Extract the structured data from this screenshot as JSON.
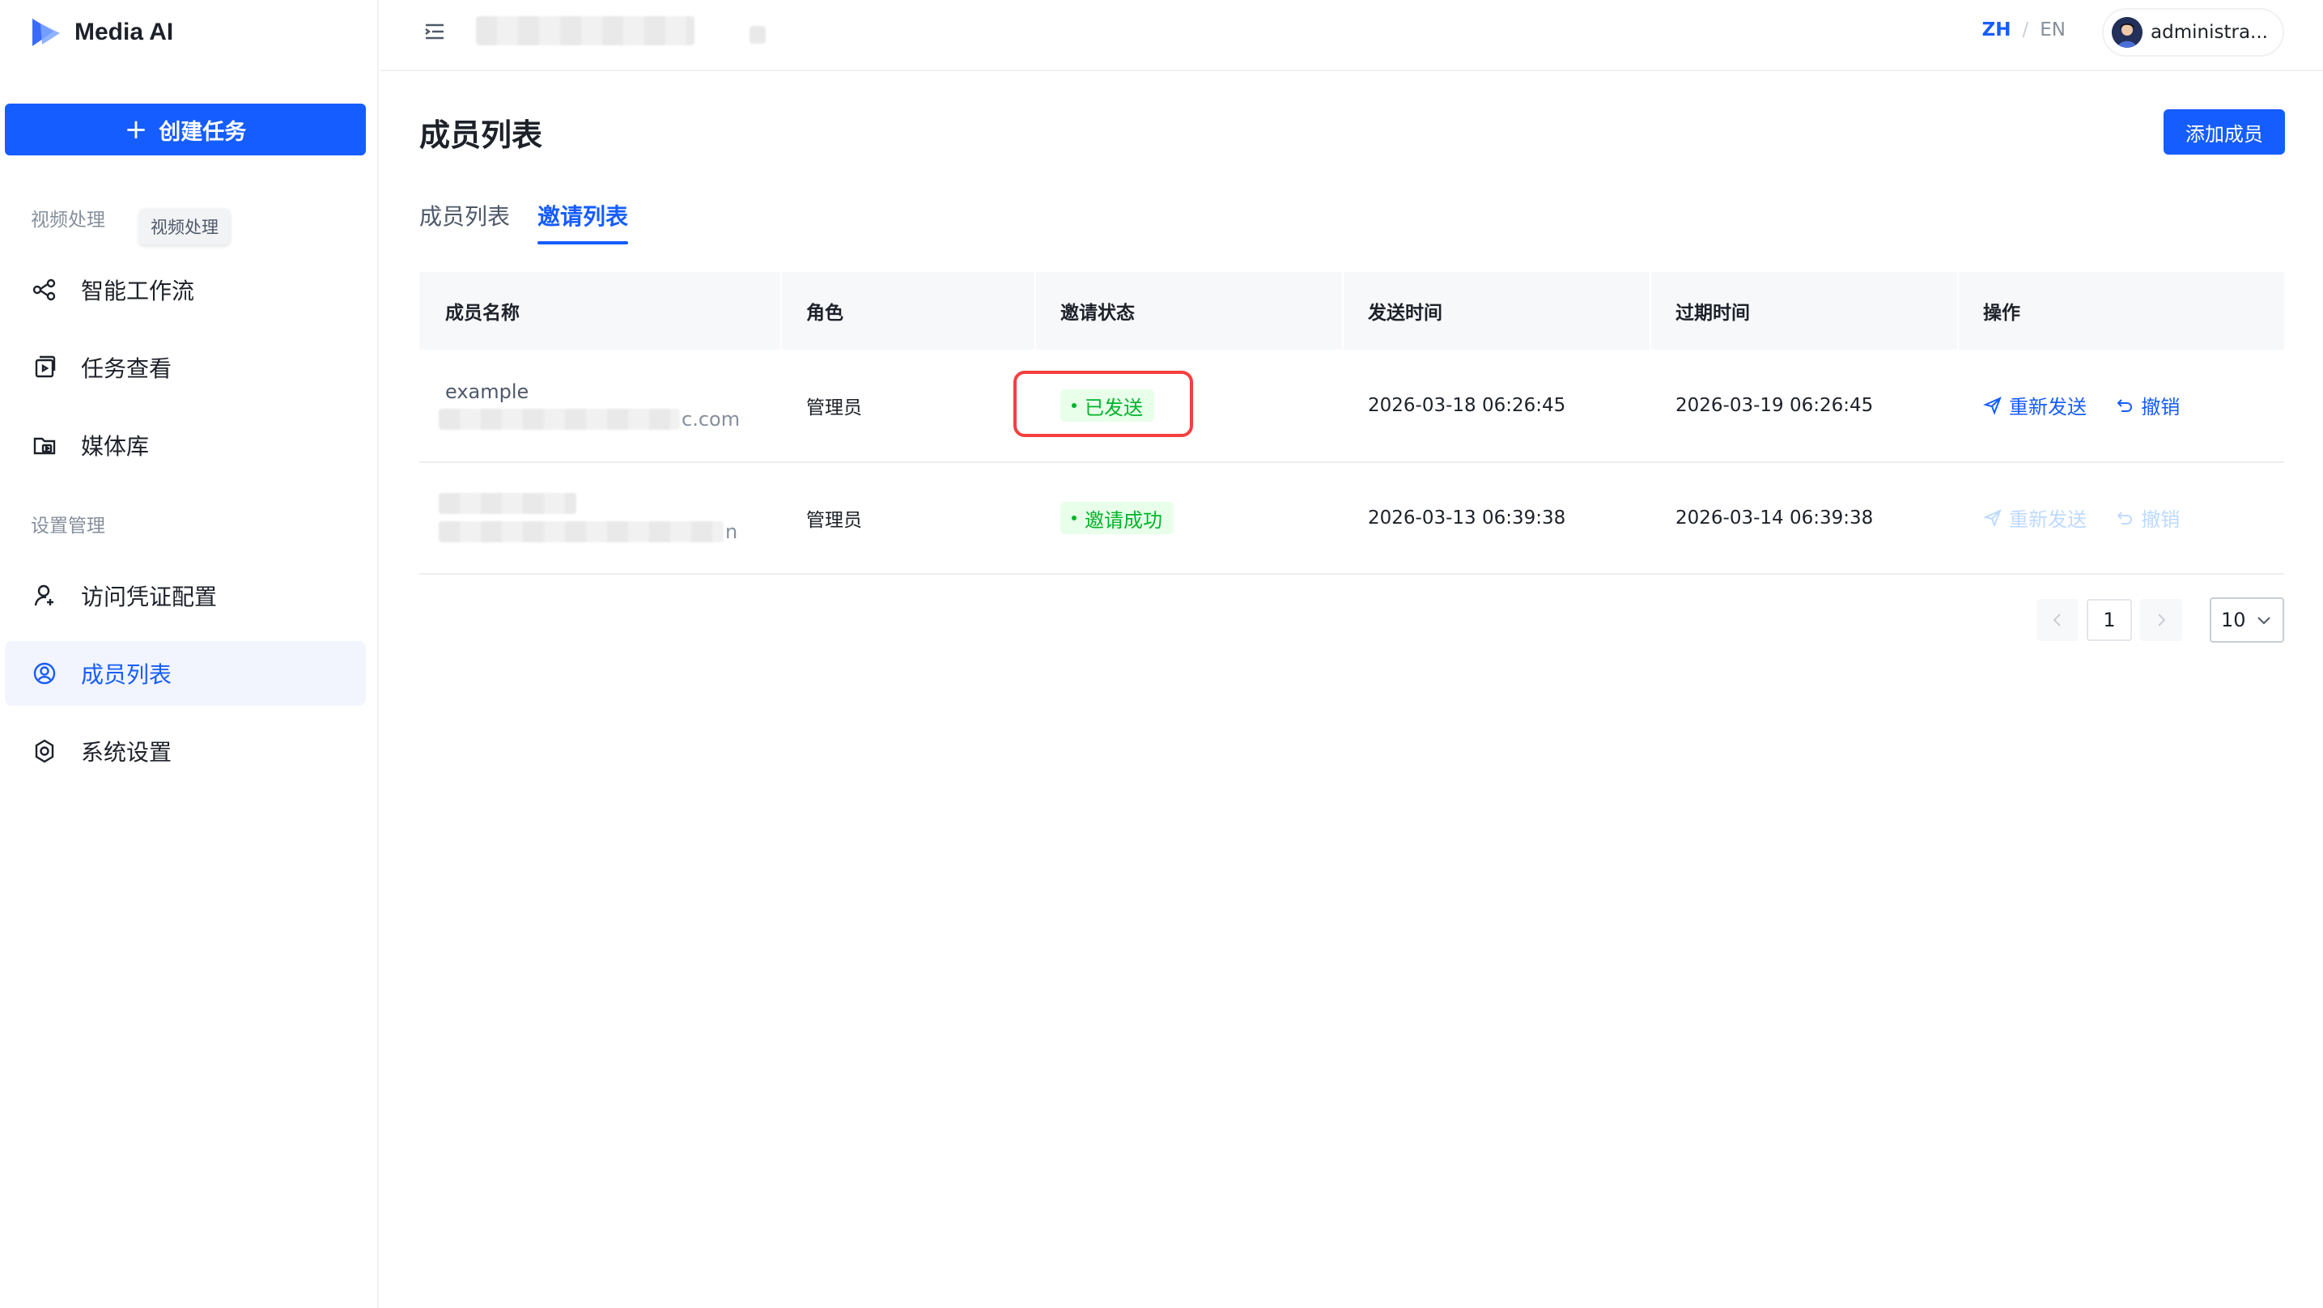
{
  "brand": {
    "name": "Media AI"
  },
  "sidebar": {
    "create_label": "创建任务",
    "sections": [
      {
        "title": "视频处理"
      },
      {
        "title": "设置管理"
      }
    ],
    "tooltip": "视频处理",
    "items": [
      {
        "label": "智能工作流",
        "icon": "workflow-icon"
      },
      {
        "label": "任务查看",
        "icon": "task-icon"
      },
      {
        "label": "媒体库",
        "icon": "media-library-icon"
      },
      {
        "label": "访问凭证配置",
        "icon": "credential-icon"
      },
      {
        "label": "成员列表",
        "icon": "member-icon"
      },
      {
        "label": "系统设置",
        "icon": "gear-icon"
      }
    ],
    "active_index": 4
  },
  "header": {
    "lang_zh": "ZH",
    "lang_sep": "/",
    "lang_en": "EN",
    "user_name": "administra..."
  },
  "page": {
    "title": "成员列表",
    "add_button": "添加成员",
    "tabs": [
      {
        "label": "成员列表"
      },
      {
        "label": "邀请列表"
      }
    ],
    "active_tab": 1
  },
  "table": {
    "columns": [
      "成员名称",
      "角色",
      "邀请状态",
      "发送时间",
      "过期时间",
      "操作"
    ],
    "rows": [
      {
        "name": "example",
        "email_suffix": "c.com",
        "role": "管理员",
        "status": "已发送",
        "sent_at": "2026-03-18 06:26:45",
        "expires_at": "2026-03-19 06:26:45",
        "resend": "重新发送",
        "revoke": "撤销"
      },
      {
        "name": "",
        "email_suffix": "n",
        "role": "管理员",
        "status": "邀请成功",
        "sent_at": "2026-03-13 06:39:38",
        "expires_at": "2026-03-14 06:39:38",
        "resend": "重新发送",
        "revoke": "撤销"
      }
    ]
  },
  "pagination": {
    "current_page": "1",
    "page_size": "10"
  },
  "colors": {
    "primary": "#165dff",
    "success": "#00b42a",
    "highlight": "#f53f3f"
  }
}
